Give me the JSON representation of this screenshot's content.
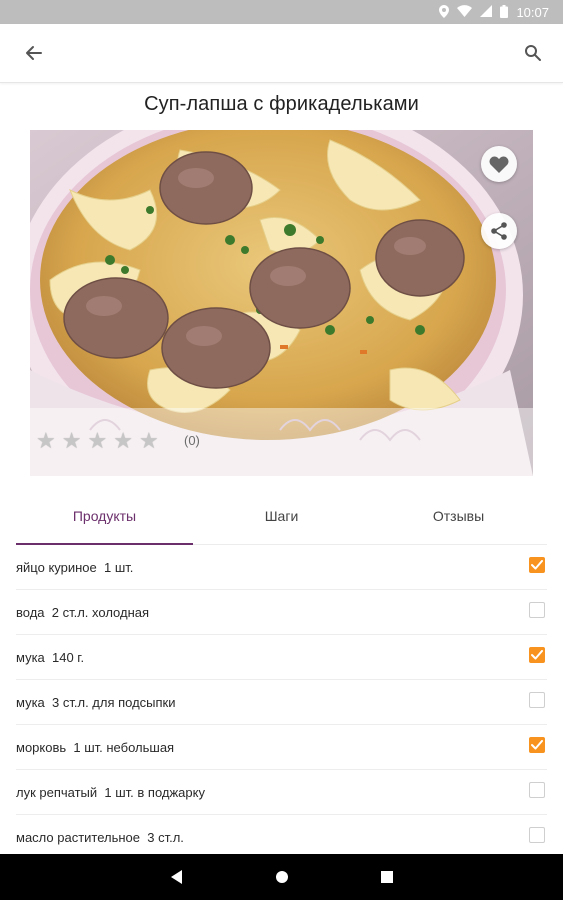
{
  "statusbar": {
    "time": "10:07",
    "icons": [
      "location-icon",
      "wifi-icon",
      "signal-icon",
      "battery-icon"
    ]
  },
  "appbar": {
    "back_icon": "arrow-left-icon",
    "search_icon": "search-icon"
  },
  "recipe": {
    "title": "Суп-лапша с фрикадельками",
    "rating_count": "(0)",
    "stars_total": 5,
    "stars_filled": 0
  },
  "actions": {
    "favorite_icon": "heart-icon",
    "share_icon": "share-icon"
  },
  "tabs": [
    {
      "label": "Продукты",
      "active": true
    },
    {
      "label": "Шаги",
      "active": false
    },
    {
      "label": "Отзывы",
      "active": false
    }
  ],
  "ingredients": [
    {
      "text": "яйцо куриное  1 шт.",
      "checked": true
    },
    {
      "text": "вода  2 ст.л. холодная",
      "checked": false
    },
    {
      "text": "мука  140 г.",
      "checked": true
    },
    {
      "text": "мука  3 ст.л. для подсыпки",
      "checked": false
    },
    {
      "text": "морковь  1 шт. небольшая",
      "checked": true
    },
    {
      "text": "лук репчатый  1 шт. в поджарку",
      "checked": false
    },
    {
      "text": "масло растительное  3 ст.л.",
      "checked": false
    }
  ],
  "colors": {
    "accent": "#6b2f6b",
    "checkbox": "#f7931e"
  },
  "navbar": {
    "icons": [
      "back-triangle-icon",
      "home-circle-icon",
      "recents-square-icon"
    ]
  }
}
